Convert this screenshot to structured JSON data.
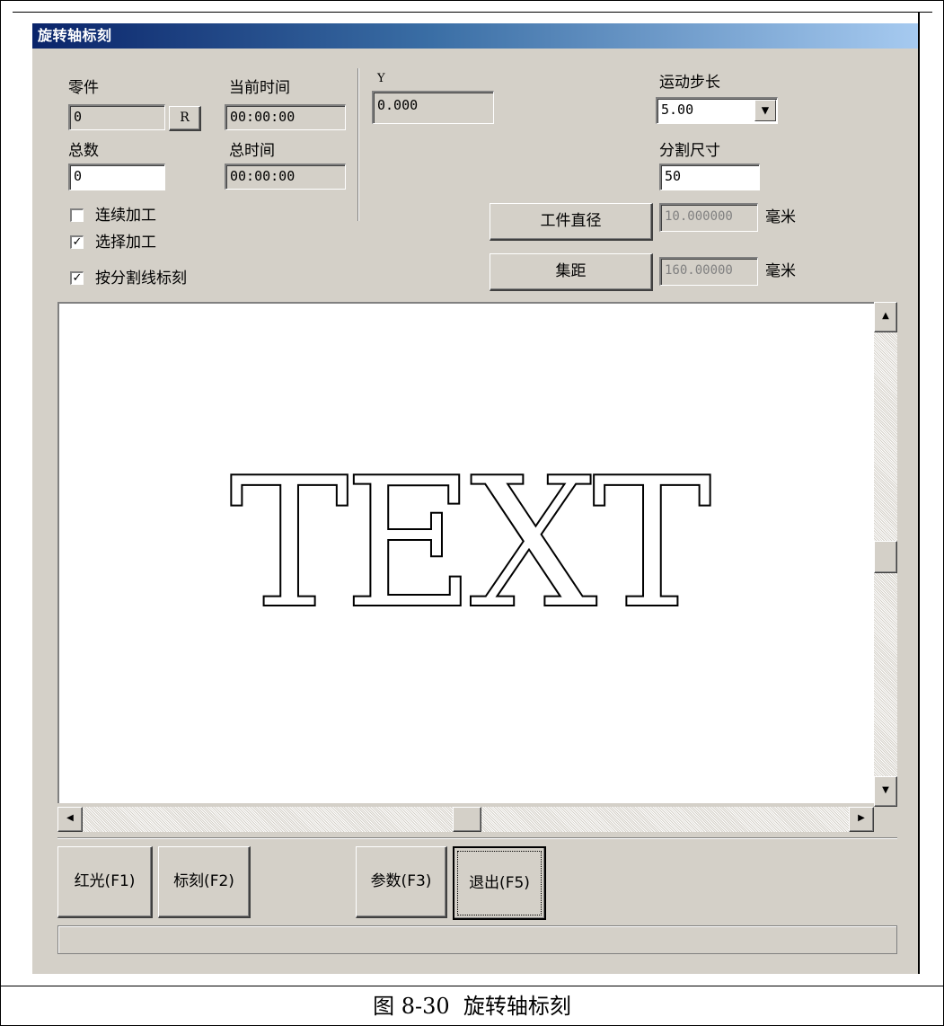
{
  "window": {
    "title": "旋转轴标刻"
  },
  "counters": {
    "part_label": "零件",
    "part_value": "0",
    "reset_label": "R",
    "total_label": "总数",
    "total_value": "0",
    "current_time_label": "当前时间",
    "current_time_value": "00:00:00",
    "total_time_label": "总时间",
    "total_time_value": "00:00:00"
  },
  "options": {
    "continuous": {
      "label": "连续加工",
      "checked": false
    },
    "select": {
      "label": "选择加工",
      "checked": true
    },
    "split_mark": {
      "label": "按分割线标刻",
      "checked": true
    }
  },
  "axis": {
    "y_label": "Y",
    "y_value": "0.000"
  },
  "motion": {
    "step_label": "运动步长",
    "step_value": "5.00",
    "split_size_label": "分割尺寸",
    "split_size_value": "50"
  },
  "workpiece": {
    "diameter_button": "工件直径",
    "diameter_value": "10.000000",
    "focal_button": "集距",
    "focal_value": "160.00000",
    "unit": "毫米"
  },
  "preview": {
    "text": "TEXT"
  },
  "buttons": {
    "red_light": "红光(F1)",
    "mark": "标刻(F2)",
    "params": "参数(F3)",
    "exit": "退出(F5)"
  },
  "caption": "图 8-30  旋转轴标刻"
}
